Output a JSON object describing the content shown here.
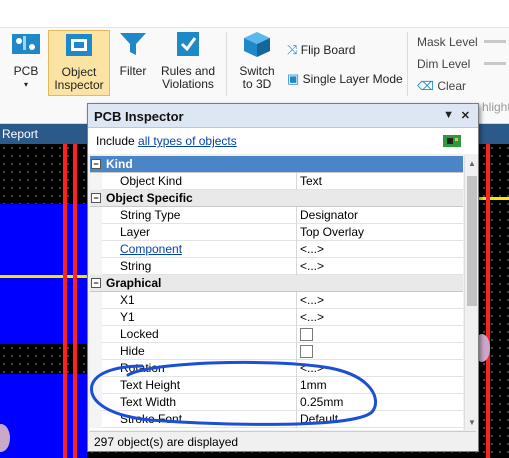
{
  "ribbon": {
    "buttons": [
      {
        "label": "PCB",
        "selected": false
      },
      {
        "label": "Object\nInspector",
        "selected": true
      },
      {
        "label": "Filter",
        "selected": false
      },
      {
        "label": "Rules and\nViolations",
        "selected": false
      },
      {
        "label": "Switch\nto 3D",
        "selected": false
      }
    ],
    "flip_board": "Flip Board",
    "single_layer_mode": "Single Layer Mode",
    "mask_level": "Mask Level",
    "dim_level": "Dim Level",
    "clear": "Clear",
    "highlight_partial": "hlight"
  },
  "report_tab": "Report",
  "inspector": {
    "title": "PCB Inspector",
    "include_prefix": "Include",
    "include_link": "all types of objects",
    "categories": [
      {
        "name": "Kind",
        "active": true,
        "rows": [
          {
            "key": "Object Kind",
            "value": "Text"
          }
        ]
      },
      {
        "name": "Object Specific",
        "active": false,
        "rows": [
          {
            "key": "String Type",
            "value": "Designator"
          },
          {
            "key": "Layer",
            "value": "Top Overlay"
          },
          {
            "key": "Component",
            "value": "<...>",
            "link": true
          },
          {
            "key": "String",
            "value": "<...>"
          }
        ]
      },
      {
        "name": "Graphical",
        "active": false,
        "rows": [
          {
            "key": "X1",
            "value": "<...>"
          },
          {
            "key": "Y1",
            "value": "<...>"
          },
          {
            "key": "Locked",
            "value": "",
            "checkbox": true
          },
          {
            "key": "Hide",
            "value": "",
            "checkbox": true
          },
          {
            "key": "Rotation",
            "value": "<...>"
          },
          {
            "key": "Text Height",
            "value": "1mm"
          },
          {
            "key": "Text Width",
            "value": "0.25mm"
          },
          {
            "key": "Stroke Font",
            "value": "Default"
          }
        ]
      }
    ],
    "status": "297 object(s) are displayed"
  },
  "colors": {
    "ribbon_bg": "#f9f9f9",
    "selected_button": "#fbe4a3",
    "category_active": "#4a86c7",
    "annotation_ellipse": "#1a4fd6",
    "pcb_blue": "#0000ff",
    "pcb_red": "#ff2020",
    "pcb_yellow": "#f6e600"
  }
}
